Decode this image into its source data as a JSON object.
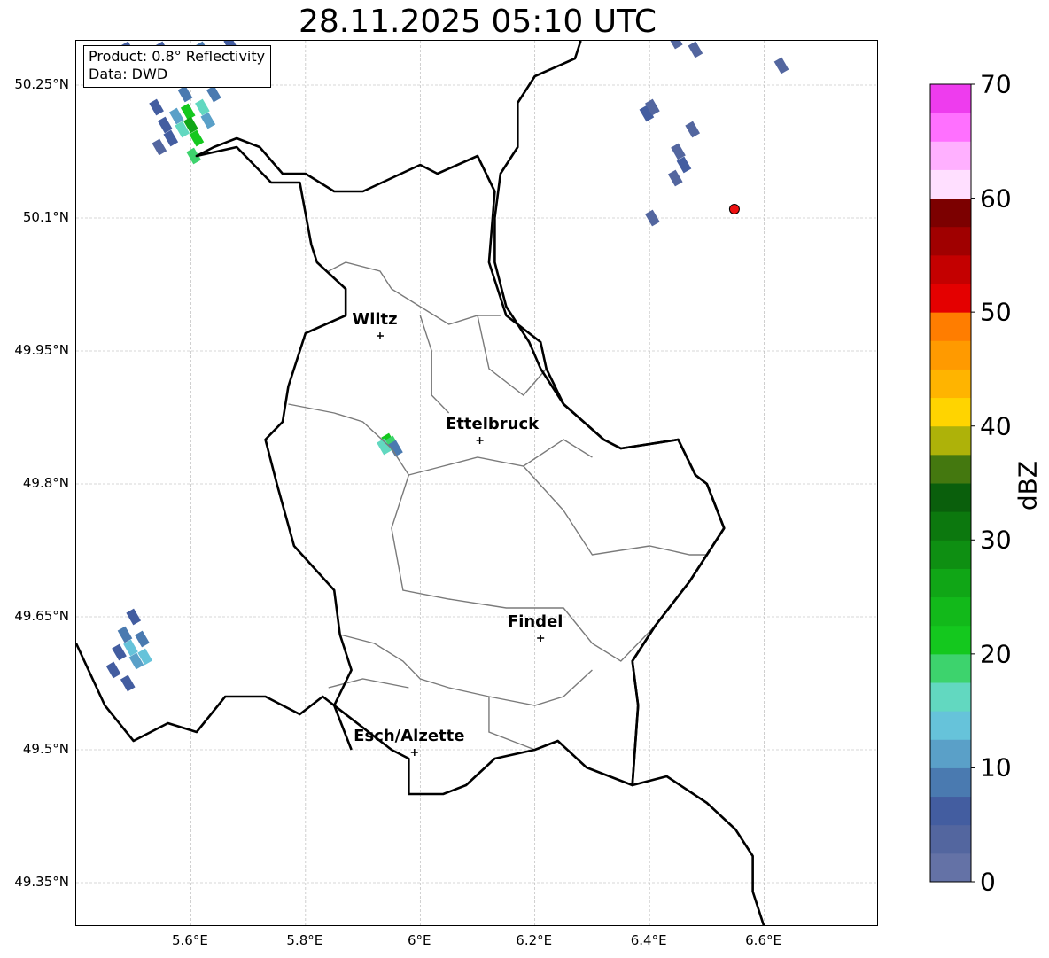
{
  "title": "28.11.2025 05:10 UTC",
  "info": {
    "product": "Product: 0.8° Reflectivity",
    "data": "Data: DWD"
  },
  "axes": {
    "lon_range": [
      5.4,
      6.8
    ],
    "lat_range": [
      49.3,
      50.3
    ],
    "x_ticks": [
      {
        "value": 5.6,
        "label": "5.6°E"
      },
      {
        "value": 5.8,
        "label": "5.8°E"
      },
      {
        "value": 6.0,
        "label": "6°E"
      },
      {
        "value": 6.2,
        "label": "6.2°E"
      },
      {
        "value": 6.4,
        "label": "6.4°E"
      },
      {
        "value": 6.6,
        "label": "6.6°E"
      }
    ],
    "y_ticks": [
      {
        "value": 49.35,
        "label": "49.35°N"
      },
      {
        "value": 49.5,
        "label": "49.5°N"
      },
      {
        "value": 49.65,
        "label": "49.65°N"
      },
      {
        "value": 49.8,
        "label": "49.8°N"
      },
      {
        "value": 49.95,
        "label": "49.95°N"
      },
      {
        "value": 50.1,
        "label": "50.1°N"
      },
      {
        "value": 50.25,
        "label": "50.25°N"
      }
    ],
    "grid": true
  },
  "cities": [
    {
      "name": "Wiltz",
      "lon": 5.93,
      "lat": 49.967
    },
    {
      "name": "Ettelbruck",
      "lon": 6.104,
      "lat": 49.849
    },
    {
      "name": "Findel",
      "lon": 6.21,
      "lat": 49.626
    },
    {
      "name": "Esch/Alzette",
      "lon": 5.99,
      "lat": 49.497
    }
  ],
  "radar_site": {
    "lon": 6.548,
    "lat": 50.11,
    "color": "#ee1111"
  },
  "colorbar": {
    "unit": "dBZ",
    "min": 0,
    "max": 70,
    "step": 2.5,
    "tick_labels": [
      "0",
      "10",
      "20",
      "30",
      "40",
      "50",
      "60",
      "70"
    ],
    "colors": [
      "#6472a6",
      "#53669f",
      "#435da0",
      "#4a7ab0",
      "#5aa0c8",
      "#66c3da",
      "#62d8c0",
      "#3dd36d",
      "#14c81e",
      "#12b91a",
      "#10a616",
      "#0e8f12",
      "#0c780e",
      "#0a5f0c",
      "#44780f",
      "#aeb209",
      "#ffd400",
      "#ffb400",
      "#ff9a00",
      "#ff7d00",
      "#e40000",
      "#c40000",
      "#a00000",
      "#7c0000",
      "#ffdfff",
      "#ffb0ff",
      "#ff70ff",
      "#ee3cee"
    ]
  },
  "echoes": [
    {
      "lon": 5.555,
      "lat": 50.205,
      "dbz": 5
    },
    {
      "lon": 5.565,
      "lat": 50.19,
      "dbz": 7
    },
    {
      "lon": 5.575,
      "lat": 50.215,
      "dbz": 12
    },
    {
      "lon": 5.585,
      "lat": 50.2,
      "dbz": 16
    },
    {
      "lon": 5.595,
      "lat": 50.22,
      "dbz": 20
    },
    {
      "lon": 5.6,
      "lat": 50.205,
      "dbz": 25
    },
    {
      "lon": 5.61,
      "lat": 50.19,
      "dbz": 22
    },
    {
      "lon": 5.605,
      "lat": 50.17,
      "dbz": 18
    },
    {
      "lon": 5.62,
      "lat": 50.225,
      "dbz": 15
    },
    {
      "lon": 5.63,
      "lat": 50.21,
      "dbz": 10
    },
    {
      "lon": 5.54,
      "lat": 50.225,
      "dbz": 6
    },
    {
      "lon": 5.545,
      "lat": 50.18,
      "dbz": 4
    },
    {
      "lon": 5.59,
      "lat": 50.24,
      "dbz": 8
    },
    {
      "lon": 5.64,
      "lat": 50.24,
      "dbz": 9
    },
    {
      "lon": 5.49,
      "lat": 50.29,
      "dbz": 5
    },
    {
      "lon": 5.55,
      "lat": 50.29,
      "dbz": 6
    },
    {
      "lon": 5.62,
      "lat": 50.29,
      "dbz": 8
    },
    {
      "lon": 5.67,
      "lat": 50.295,
      "dbz": 5
    },
    {
      "lon": 5.475,
      "lat": 49.61,
      "dbz": 6
    },
    {
      "lon": 5.485,
      "lat": 49.63,
      "dbz": 9
    },
    {
      "lon": 5.495,
      "lat": 49.615,
      "dbz": 13
    },
    {
      "lon": 5.505,
      "lat": 49.6,
      "dbz": 11
    },
    {
      "lon": 5.515,
      "lat": 49.625,
      "dbz": 8
    },
    {
      "lon": 5.52,
      "lat": 49.605,
      "dbz": 14
    },
    {
      "lon": 5.465,
      "lat": 49.59,
      "dbz": 5
    },
    {
      "lon": 5.5,
      "lat": 49.65,
      "dbz": 5
    },
    {
      "lon": 5.49,
      "lat": 49.575,
      "dbz": 7
    },
    {
      "lon": 5.945,
      "lat": 49.848,
      "dbz": 22
    },
    {
      "lon": 5.952,
      "lat": 49.845,
      "dbz": 18
    },
    {
      "lon": 5.937,
      "lat": 49.842,
      "dbz": 16
    },
    {
      "lon": 5.957,
      "lat": 49.84,
      "dbz": 8
    },
    {
      "lon": 6.395,
      "lat": 50.218,
      "dbz": 5
    },
    {
      "lon": 6.405,
      "lat": 50.225,
      "dbz": 4
    },
    {
      "lon": 6.45,
      "lat": 50.175,
      "dbz": 4
    },
    {
      "lon": 6.46,
      "lat": 50.16,
      "dbz": 5
    },
    {
      "lon": 6.445,
      "lat": 50.145,
      "dbz": 4
    },
    {
      "lon": 6.475,
      "lat": 50.2,
      "dbz": 3
    },
    {
      "lon": 6.405,
      "lat": 50.1,
      "dbz": 3
    },
    {
      "lon": 6.63,
      "lat": 50.272,
      "dbz": 4
    },
    {
      "lon": 6.445,
      "lat": 50.3,
      "dbz": 3
    },
    {
      "lon": 6.48,
      "lat": 50.29,
      "dbz": 3
    }
  ],
  "borders": {
    "luxembourg": [
      [
        5.61,
        50.17
      ],
      [
        5.68,
        50.18
      ],
      [
        5.74,
        50.14
      ],
      [
        5.79,
        50.14
      ],
      [
        5.81,
        50.07
      ],
      [
        5.82,
        50.05
      ],
      [
        5.87,
        50.02
      ],
      [
        5.87,
        49.99
      ],
      [
        5.8,
        49.97
      ],
      [
        5.77,
        49.91
      ],
      [
        5.76,
        49.87
      ],
      [
        5.73,
        49.85
      ],
      [
        5.75,
        49.8
      ],
      [
        5.78,
        49.73
      ],
      [
        5.85,
        49.68
      ],
      [
        5.86,
        49.63
      ],
      [
        5.88,
        49.59
      ],
      [
        5.85,
        49.55
      ],
      [
        5.95,
        49.5
      ],
      [
        5.98,
        49.49
      ],
      [
        5.98,
        49.45
      ],
      [
        6.04,
        49.45
      ],
      [
        6.08,
        49.46
      ],
      [
        6.13,
        49.49
      ],
      [
        6.2,
        49.5
      ],
      [
        6.24,
        49.51
      ],
      [
        6.29,
        49.48
      ],
      [
        6.37,
        49.46
      ],
      [
        6.38,
        49.55
      ],
      [
        6.37,
        49.6
      ],
      [
        6.41,
        49.64
      ],
      [
        6.47,
        49.69
      ],
      [
        6.5,
        49.72
      ],
      [
        6.53,
        49.75
      ],
      [
        6.5,
        49.8
      ],
      [
        6.48,
        49.81
      ],
      [
        6.45,
        49.85
      ],
      [
        6.35,
        49.84
      ],
      [
        6.32,
        49.85
      ],
      [
        6.25,
        49.89
      ],
      [
        6.22,
        49.93
      ],
      [
        6.21,
        49.96
      ],
      [
        6.15,
        49.99
      ],
      [
        6.12,
        50.05
      ],
      [
        6.13,
        50.13
      ],
      [
        6.1,
        50.17
      ],
      [
        6.03,
        50.15
      ],
      [
        6.0,
        50.16
      ],
      [
        5.9,
        50.13
      ],
      [
        5.85,
        50.13
      ],
      [
        5.8,
        50.15
      ],
      [
        5.76,
        50.15
      ],
      [
        5.72,
        50.18
      ],
      [
        5.68,
        50.19
      ],
      [
        5.64,
        50.18
      ],
      [
        5.61,
        50.17
      ]
    ],
    "germany": [
      [
        6.28,
        50.3
      ],
      [
        6.27,
        50.28
      ],
      [
        6.2,
        50.26
      ],
      [
        6.17,
        50.23
      ],
      [
        6.17,
        50.18
      ],
      [
        6.14,
        50.15
      ],
      [
        6.13,
        50.1
      ],
      [
        6.13,
        50.05
      ],
      [
        6.15,
        50.0
      ],
      [
        6.19,
        49.96
      ],
      [
        6.21,
        49.93
      ],
      [
        6.25,
        49.89
      ],
      [
        6.32,
        49.85
      ],
      [
        6.35,
        49.84
      ],
      [
        6.45,
        49.85
      ],
      [
        6.48,
        49.81
      ],
      [
        6.5,
        49.8
      ],
      [
        6.53,
        49.75
      ],
      [
        6.5,
        49.72
      ],
      [
        6.47,
        49.69
      ],
      [
        6.41,
        49.64
      ],
      [
        6.37,
        49.6
      ],
      [
        6.38,
        49.55
      ],
      [
        6.37,
        49.46
      ],
      [
        6.43,
        49.47
      ],
      [
        6.5,
        49.44
      ],
      [
        6.55,
        49.41
      ],
      [
        6.58,
        49.38
      ],
      [
        6.58,
        49.34
      ],
      [
        6.6,
        49.3
      ]
    ],
    "belgium_france": [
      [
        5.4,
        49.62
      ],
      [
        5.45,
        49.55
      ],
      [
        5.5,
        49.51
      ],
      [
        5.56,
        49.53
      ],
      [
        5.61,
        49.52
      ],
      [
        5.66,
        49.56
      ],
      [
        5.73,
        49.56
      ],
      [
        5.79,
        49.54
      ],
      [
        5.83,
        49.56
      ],
      [
        5.85,
        49.55
      ],
      [
        5.88,
        49.5
      ]
    ]
  },
  "cantons": [
    [
      [
        5.84,
        50.04
      ],
      [
        5.87,
        50.05
      ],
      [
        5.93,
        50.04
      ],
      [
        5.95,
        50.02
      ],
      [
        6.0,
        50.0
      ],
      [
        6.05,
        49.98
      ],
      [
        6.1,
        49.99
      ],
      [
        6.14,
        49.99
      ]
    ],
    [
      [
        5.77,
        49.89
      ],
      [
        5.85,
        49.88
      ],
      [
        5.9,
        49.87
      ],
      [
        5.95,
        49.84
      ],
      [
        5.98,
        49.81
      ],
      [
        6.04,
        49.82
      ],
      [
        6.1,
        49.83
      ],
      [
        6.18,
        49.82
      ],
      [
        6.25,
        49.85
      ],
      [
        6.3,
        49.83
      ]
    ],
    [
      [
        6.0,
        49.99
      ],
      [
        6.02,
        49.95
      ],
      [
        6.02,
        49.9
      ],
      [
        6.05,
        49.88
      ]
    ],
    [
      [
        6.1,
        49.99
      ],
      [
        6.12,
        49.93
      ],
      [
        6.18,
        49.9
      ],
      [
        6.22,
        49.93
      ]
    ],
    [
      [
        5.98,
        49.81
      ],
      [
        5.95,
        49.75
      ],
      [
        5.97,
        49.68
      ],
      [
        6.05,
        49.67
      ],
      [
        6.15,
        49.66
      ],
      [
        6.25,
        49.66
      ],
      [
        6.3,
        49.62
      ],
      [
        6.35,
        49.6
      ],
      [
        6.41,
        49.64
      ]
    ],
    [
      [
        6.18,
        49.82
      ],
      [
        6.25,
        49.77
      ],
      [
        6.3,
        49.72
      ],
      [
        6.4,
        49.73
      ],
      [
        6.47,
        49.72
      ],
      [
        6.5,
        49.72
      ]
    ],
    [
      [
        5.86,
        49.63
      ],
      [
        5.92,
        49.62
      ],
      [
        5.97,
        49.6
      ],
      [
        6.0,
        49.58
      ],
      [
        6.05,
        49.57
      ],
      [
        6.12,
        49.56
      ],
      [
        6.2,
        49.55
      ],
      [
        6.25,
        49.56
      ],
      [
        6.3,
        49.59
      ]
    ],
    [
      [
        6.12,
        49.56
      ],
      [
        6.12,
        49.52
      ],
      [
        6.2,
        49.5
      ]
    ],
    [
      [
        5.84,
        49.57
      ],
      [
        5.9,
        49.58
      ],
      [
        5.98,
        49.57
      ]
    ]
  ]
}
